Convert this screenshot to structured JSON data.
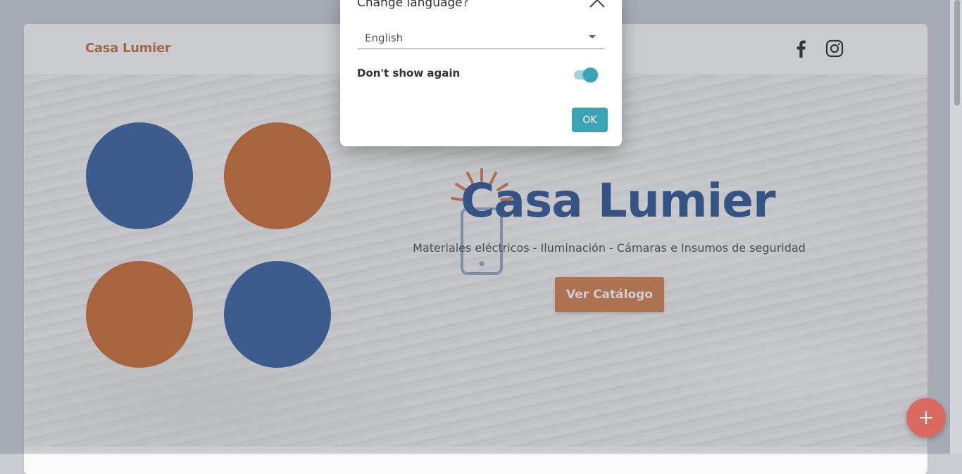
{
  "navbar": {
    "brand": "Casa Lumier",
    "social": [
      "facebook-icon",
      "instagram-icon"
    ]
  },
  "hero": {
    "title": "Casa Lumier",
    "subtitle": "Materiales eléctricos - Iluminación - Cámaras e Insumos de seguridad",
    "cta_label": "Ver Catálogo",
    "circle_colors": [
      "#2f5b9a",
      "#c9662c",
      "#c9662c",
      "#2f5b9a"
    ]
  },
  "modal": {
    "title": "Change language?",
    "language_selected": "English",
    "dont_show_label": "Don't show again",
    "dont_show_checked": true,
    "ok_label": "OK"
  },
  "colors": {
    "brand_orange": "#c26a3a",
    "brand_blue": "#26508f",
    "accent_teal": "#3aa3b4",
    "fab_red": "#d96a62"
  },
  "fab": {
    "icon": "plus-icon"
  }
}
